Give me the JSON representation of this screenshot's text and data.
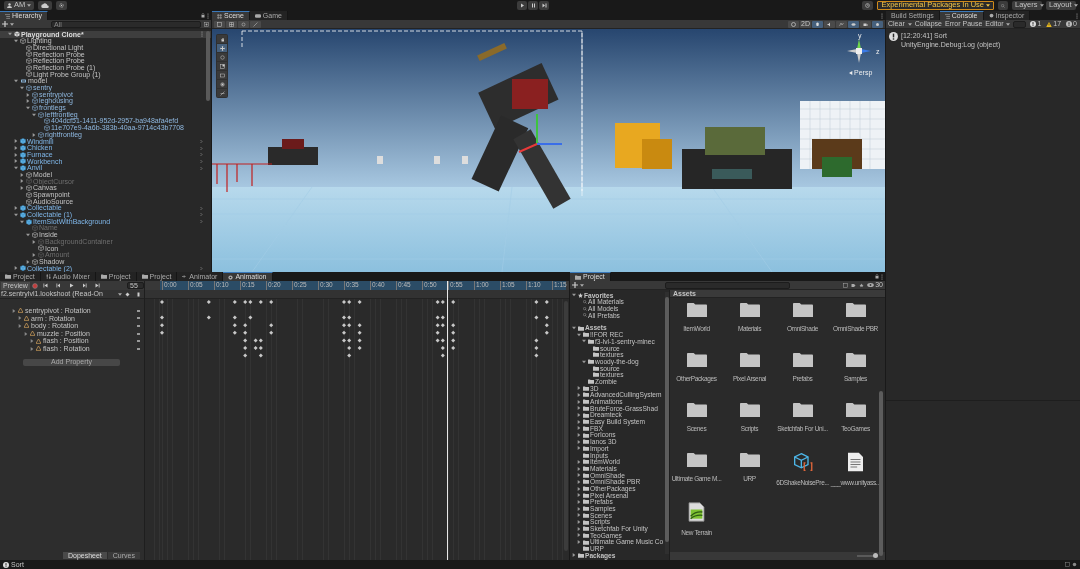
{
  "toolbar": {
    "account": "AM",
    "experimental_badge": "Experimental Packages In Use",
    "layers": "Layers",
    "layout": "Layout"
  },
  "hierarchy": {
    "title": "Hierarchy",
    "search": {
      "placeholder": "All"
    },
    "items": [
      {
        "label": "Playground Clone*",
        "kind": "scene",
        "expanded": true,
        "children": [
          {
            "label": "Lighting",
            "kind": "object",
            "expanded": true,
            "children": [
              {
                "label": "Directional Light",
                "kind": "object"
              },
              {
                "label": "Reflection Probe",
                "kind": "object"
              },
              {
                "label": "Reflection Probe",
                "kind": "object"
              },
              {
                "label": "Reflection Probe (1)",
                "kind": "object"
              },
              {
                "label": "Light Probe Group (1)",
                "kind": "object"
              }
            ]
          },
          {
            "label": "model",
            "kind": "model",
            "expanded": true,
            "children": [
              {
                "label": "sentry",
                "kind": "prefab-part",
                "expanded": true,
                "children": [
                  {
                    "label": "sentrypivot",
                    "kind": "prefab-part",
                    "expanded": false
                  },
                  {
                    "label": "leghousing",
                    "kind": "prefab-part",
                    "expanded": false
                  },
                  {
                    "label": "frontlegs",
                    "kind": "prefab-part",
                    "expanded": true,
                    "children": [
                      {
                        "label": "leftfrontleg",
                        "kind": "prefab-part",
                        "expanded": true,
                        "children": [
                          {
                            "label": "404dcf51-1411-952d-2957-ba948afa4efd",
                            "kind": "prefab-part"
                          },
                          {
                            "label": "11e707e9-4a6b-383b-40aa-9714c43b7708",
                            "kind": "prefab-part"
                          }
                        ]
                      },
                      {
                        "label": "rightfrontleg",
                        "kind": "prefab-part",
                        "expanded": false
                      }
                    ]
                  }
                ]
              }
            ]
          },
          {
            "label": "Windmill",
            "kind": "prefab",
            "expanded": false
          },
          {
            "label": "Chicken",
            "kind": "prefab",
            "expanded": false
          },
          {
            "label": "Furnace",
            "kind": "prefab",
            "expanded": false
          },
          {
            "label": "Workbench",
            "kind": "prefab",
            "expanded": false
          },
          {
            "label": "Anvil",
            "kind": "prefab",
            "expanded": true,
            "children": [
              {
                "label": "Model",
                "kind": "object",
                "expanded": false
              },
              {
                "label": "ObjectCursor",
                "kind": "inactive",
                "expanded": false
              },
              {
                "label": "Canvas",
                "kind": "object",
                "expanded": false
              },
              {
                "label": "Spawnpoint",
                "kind": "object"
              },
              {
                "label": "AudioSource",
                "kind": "object"
              }
            ]
          },
          {
            "label": "Collectable",
            "kind": "prefab",
            "expanded": false
          },
          {
            "label": "Collectable (1)",
            "kind": "prefab",
            "expanded": true,
            "children": [
              {
                "label": "ItemSlotWithBackground",
                "kind": "prefab",
                "expanded": true,
                "children": [
                  {
                    "label": "Name",
                    "kind": "inactive"
                  },
                  {
                    "label": "Inside",
                    "kind": "object",
                    "expanded": true,
                    "children": [
                      {
                        "label": "BackgroundContainer",
                        "kind": "inactive",
                        "expanded": false
                      },
                      {
                        "label": "Icon",
                        "kind": "object"
                      },
                      {
                        "label": "Amount",
                        "kind": "inactive",
                        "expanded": false
                      }
                    ]
                  },
                  {
                    "label": "Shadow",
                    "kind": "object",
                    "expanded": false
                  }
                ]
              }
            ]
          },
          {
            "label": "Collectable (2)",
            "kind": "prefab",
            "expanded": false
          }
        ]
      }
    ]
  },
  "scene": {
    "tabs": [
      {
        "label": "Scene",
        "selected": true
      },
      {
        "label": "Game",
        "selected": false
      }
    ],
    "mode_2d": "2D",
    "gizmo": {
      "y_label": "y",
      "z_label": "z"
    },
    "projection": "Persp"
  },
  "console": {
    "tabs": [
      {
        "label": "Build Settings",
        "selected": false
      },
      {
        "label": "Console",
        "selected": true
      },
      {
        "label": "Inspector",
        "selected": false
      }
    ],
    "clear": "Clear",
    "collapse": "Collapse",
    "error_pause": "Error Pause",
    "editor": "Editor",
    "counts": {
      "info": "1",
      "warning": "17",
      "error": "0"
    },
    "entries": [
      {
        "message": "[12:20:41] Sort",
        "detail": "UnityEngine.Debug:Log (object)"
      }
    ]
  },
  "animation": {
    "tabs": [
      {
        "label": "Project",
        "kind": "project",
        "selected": false
      },
      {
        "label": "Audio Mixer",
        "kind": "audio",
        "selected": false
      },
      {
        "label": "Project",
        "kind": "project",
        "selected": false
      },
      {
        "label": "Project",
        "kind": "project",
        "selected": false
      },
      {
        "label": "Animator",
        "kind": "animator",
        "selected": false
      },
      {
        "label": "Animation",
        "kind": "animation",
        "selected": true
      }
    ],
    "preview": "Preview",
    "frame": "55",
    "clip": "f2.sentrylvl1.lookshoot (Read-On",
    "properties": [
      {
        "label": "sentrypivot : Rotation",
        "children": [
          {
            "label": "arm : Rotation"
          },
          {
            "label": "body : Rotation",
            "children": [
              {
                "label": "muzzle : Position",
                "children": [
                  {
                    "label": "flash : Position"
                  },
                  {
                    "label": "flash : Rotation"
                  }
                ]
              }
            ]
          }
        ]
      }
    ],
    "add_property": "Add Property",
    "ruler": [
      "0:00",
      "0:05",
      "0:10",
      "0:15",
      "0:20",
      "0:25",
      "0:30",
      "0:35",
      "0:40",
      "0:45",
      "0:50",
      "0:55",
      "1:00",
      "1:05",
      "1:10",
      "1:15"
    ],
    "view_tabs": [
      {
        "label": "Dopesheet",
        "selected": true
      },
      {
        "label": "Curves",
        "selected": false
      }
    ]
  },
  "project": {
    "title": "Project",
    "tree": [
      {
        "label": "Favorites",
        "kind": "favorites",
        "expanded": true,
        "children": [
          {
            "label": "All Materials",
            "kind": "search"
          },
          {
            "label": "All Models",
            "kind": "search"
          },
          {
            "label": "All Prefabs",
            "kind": "search"
          }
        ]
      },
      {
        "label": "Assets",
        "kind": "folder",
        "expanded": true,
        "children": [
          {
            "label": "!!FOR REC",
            "kind": "folder",
            "expanded": true,
            "children": [
              {
                "label": "f3-lvl-1-sentry-minec",
                "kind": "folder",
                "expanded": true,
                "children": [
                  {
                    "label": "source",
                    "kind": "folder"
                  },
                  {
                    "label": "textures",
                    "kind": "folder"
                  }
                ]
              },
              {
                "label": "woody-the-dog",
                "kind": "folder",
                "expanded": true,
                "children": [
                  {
                    "label": "source",
                    "kind": "folder"
                  },
                  {
                    "label": "textures",
                    "kind": "folder"
                  }
                ]
              },
              {
                "label": "Zombie",
                "kind": "folder"
              }
            ]
          },
          {
            "label": "3D",
            "kind": "folder",
            "expanded": false
          },
          {
            "label": "AdvancedCullingSystem",
            "kind": "folder",
            "expanded": false
          },
          {
            "label": "Animations",
            "kind": "folder",
            "expanded": false
          },
          {
            "label": "BruteForce-GrassShad",
            "kind": "folder",
            "expanded": false
          },
          {
            "label": "Dreamteck",
            "kind": "folder",
            "expanded": false
          },
          {
            "label": "Easy Build System",
            "kind": "folder",
            "expanded": false
          },
          {
            "label": "FBX",
            "kind": "folder",
            "expanded": false
          },
          {
            "label": "ForIcons",
            "kind": "folder",
            "expanded": false
          },
          {
            "label": "Ianos 3D",
            "kind": "folder",
            "expanded": false
          },
          {
            "label": "Import",
            "kind": "folder",
            "expanded": false
          },
          {
            "label": "Inputs",
            "kind": "folder"
          },
          {
            "label": "ItemWorld",
            "kind": "folder",
            "expanded": false
          },
          {
            "label": "Materials",
            "kind": "folder",
            "expanded": false
          },
          {
            "label": "OmniShade",
            "kind": "folder",
            "expanded": false
          },
          {
            "label": "OmniShade PBR",
            "kind": "folder",
            "expanded": false
          },
          {
            "label": "OtherPackages",
            "kind": "folder",
            "expanded": false
          },
          {
            "label": "Pixel Arsenal",
            "kind": "folder",
            "expanded": false
          },
          {
            "label": "Prefabs",
            "kind": "folder",
            "expanded": false
          },
          {
            "label": "Samples",
            "kind": "folder",
            "expanded": false
          },
          {
            "label": "Scenes",
            "kind": "folder",
            "expanded": false
          },
          {
            "label": "Scripts",
            "kind": "folder",
            "expanded": false
          },
          {
            "label": "Sketchfab For Unity",
            "kind": "folder",
            "expanded": false
          },
          {
            "label": "TeoGames",
            "kind": "folder",
            "expanded": false
          },
          {
            "label": "Ultimate Game Music Co",
            "kind": "folder",
            "expanded": false
          },
          {
            "label": "URP",
            "kind": "folder"
          }
        ]
      },
      {
        "label": "Packages",
        "kind": "folder",
        "expanded": false
      }
    ],
    "breadcrumb": "Assets",
    "hidden_count": "30",
    "assets": [
      {
        "name": "ItemWorld",
        "kind": "folder"
      },
      {
        "name": "Materials",
        "kind": "folder"
      },
      {
        "name": "OmniShade",
        "kind": "folder"
      },
      {
        "name": "OmniShade PBR",
        "kind": "folder"
      },
      {
        "name": "OtherPackages",
        "kind": "folder"
      },
      {
        "name": "Pixel Arsenal",
        "kind": "folder"
      },
      {
        "name": "Prefabs",
        "kind": "folder"
      },
      {
        "name": "Samples",
        "kind": "folder"
      },
      {
        "name": "Scenes",
        "kind": "folder"
      },
      {
        "name": "Scripts",
        "kind": "folder"
      },
      {
        "name": "Sketchfab For Uni...",
        "kind": "folder"
      },
      {
        "name": "TeoGames",
        "kind": "folder"
      },
      {
        "name": "Ultimate Game M...",
        "kind": "folder"
      },
      {
        "name": "URP",
        "kind": "folder"
      },
      {
        "name": "6DShakeNoisePre...",
        "kind": "preset"
      },
      {
        "name": "___www.unityass...",
        "kind": "text"
      },
      {
        "name": "New Terrain",
        "kind": "terrain"
      }
    ],
    "zoom": {
      "level": 0.92
    }
  },
  "status_bar": {
    "message": "Sort"
  }
}
